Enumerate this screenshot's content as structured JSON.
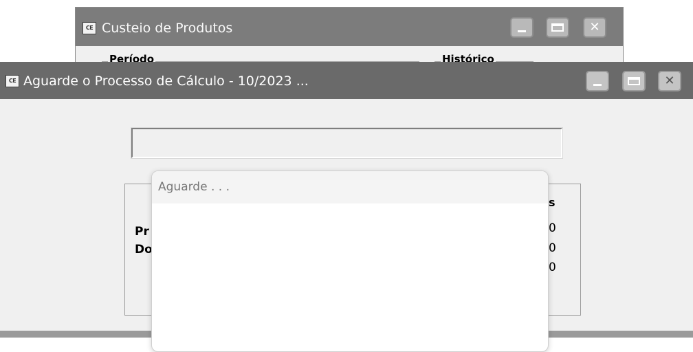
{
  "background_window": {
    "icon_text": "CE",
    "title": "Custeio de Produtos",
    "group_periodo": "Período",
    "group_historico": "Histórico"
  },
  "main_window": {
    "icon_text": "CE",
    "title": "Aguarde o Processo de Cálculo - 10/2023 ...",
    "progress": 0,
    "stats": {
      "header_fragment": "os",
      "row_labels": [
        "Pr",
        "Do"
      ],
      "values": [
        "0",
        "0",
        "0"
      ]
    }
  },
  "wait_popup": {
    "text": "Aguarde . . ."
  },
  "colors": {
    "titlebar_main": "#6a6a6a",
    "titlebar_background": "#7c7c7c",
    "window_bg": "#f0f0f0"
  }
}
